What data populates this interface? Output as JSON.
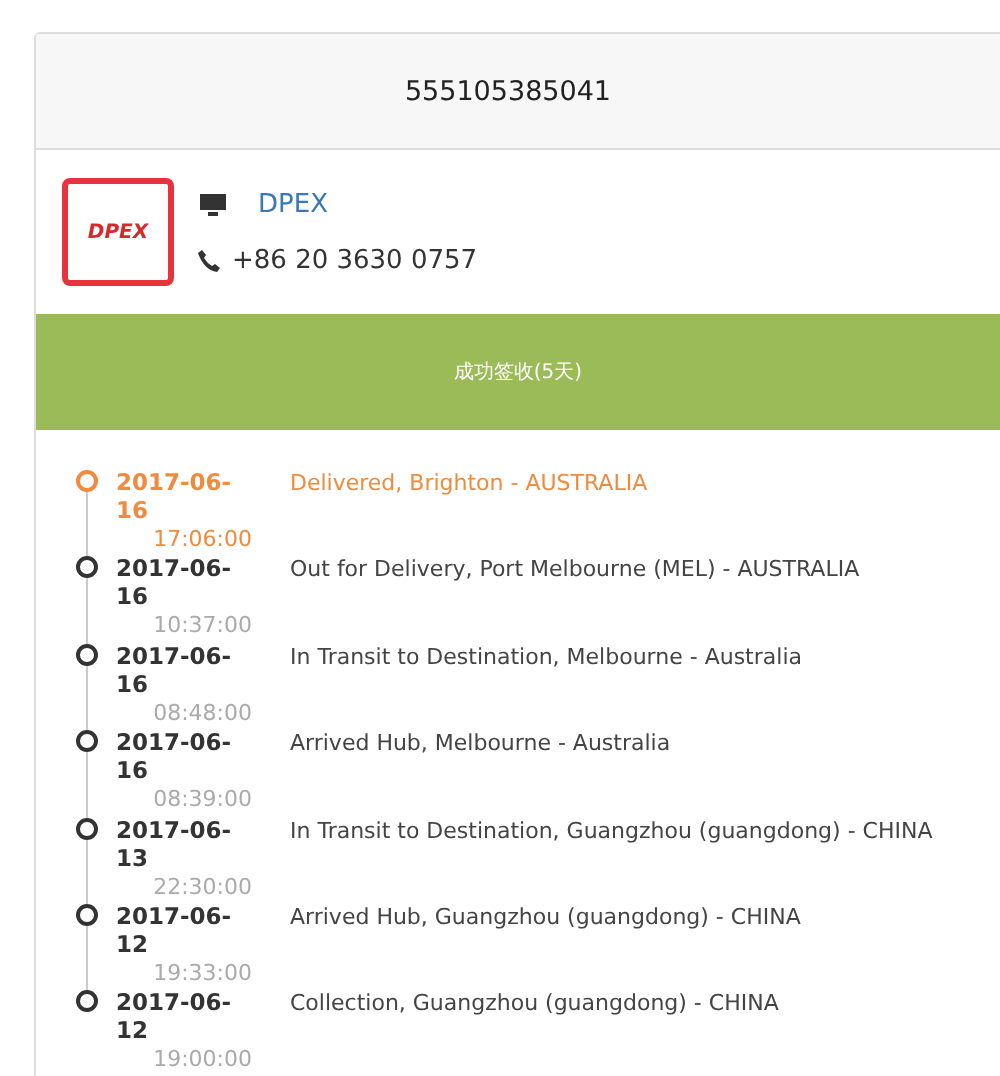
{
  "tracking_number": "555105385041",
  "carrier": {
    "logo_text": "DPEX",
    "name": "DPEX",
    "phone": "+86 20 3630 0757"
  },
  "status_banner": "成功签收(5天)",
  "events": [
    {
      "date": "2017-06-16",
      "time": "17:06:00",
      "description": "Delivered, Brighton - AUSTRALIA",
      "current": true
    },
    {
      "date": "2017-06-16",
      "time": "10:37:00",
      "description": "Out for Delivery, Port Melbourne (MEL) - AUSTRALIA",
      "current": false
    },
    {
      "date": "2017-06-16",
      "time": "08:48:00",
      "description": "In Transit to Destination, Melbourne - Australia",
      "current": false
    },
    {
      "date": "2017-06-16",
      "time": "08:39:00",
      "description": "Arrived Hub, Melbourne - Australia",
      "current": false
    },
    {
      "date": "2017-06-13",
      "time": "22:30:00",
      "description": "In Transit to Destination, Guangzhou (guangdong) - CHINA",
      "current": false
    },
    {
      "date": "2017-06-12",
      "time": "19:33:00",
      "description": "Arrived Hub, Guangzhou (guangdong) - CHINA",
      "current": false
    },
    {
      "date": "2017-06-12",
      "time": "19:00:00",
      "description": "Collection, Guangzhou (guangdong) - CHINA",
      "current": false
    }
  ]
}
